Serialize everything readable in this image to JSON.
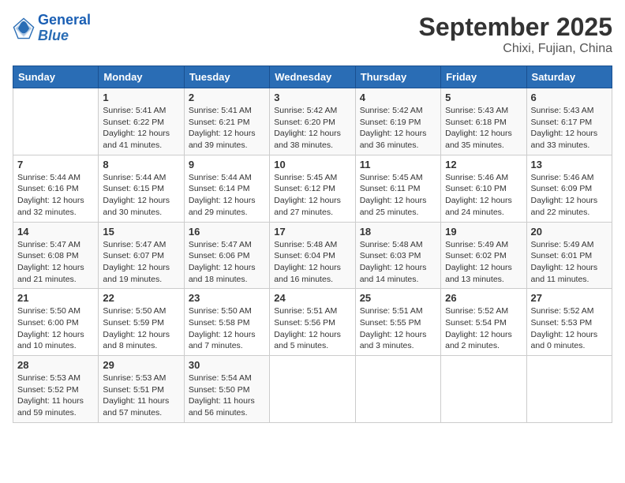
{
  "header": {
    "logo_line1": "General",
    "logo_line2": "Blue",
    "month": "September 2025",
    "location": "Chixi, Fujian, China"
  },
  "days_of_week": [
    "Sunday",
    "Monday",
    "Tuesday",
    "Wednesday",
    "Thursday",
    "Friday",
    "Saturday"
  ],
  "weeks": [
    [
      {
        "day": "",
        "info": ""
      },
      {
        "day": "1",
        "info": "Sunrise: 5:41 AM\nSunset: 6:22 PM\nDaylight: 12 hours\nand 41 minutes."
      },
      {
        "day": "2",
        "info": "Sunrise: 5:41 AM\nSunset: 6:21 PM\nDaylight: 12 hours\nand 39 minutes."
      },
      {
        "day": "3",
        "info": "Sunrise: 5:42 AM\nSunset: 6:20 PM\nDaylight: 12 hours\nand 38 minutes."
      },
      {
        "day": "4",
        "info": "Sunrise: 5:42 AM\nSunset: 6:19 PM\nDaylight: 12 hours\nand 36 minutes."
      },
      {
        "day": "5",
        "info": "Sunrise: 5:43 AM\nSunset: 6:18 PM\nDaylight: 12 hours\nand 35 minutes."
      },
      {
        "day": "6",
        "info": "Sunrise: 5:43 AM\nSunset: 6:17 PM\nDaylight: 12 hours\nand 33 minutes."
      }
    ],
    [
      {
        "day": "7",
        "info": "Sunrise: 5:44 AM\nSunset: 6:16 PM\nDaylight: 12 hours\nand 32 minutes."
      },
      {
        "day": "8",
        "info": "Sunrise: 5:44 AM\nSunset: 6:15 PM\nDaylight: 12 hours\nand 30 minutes."
      },
      {
        "day": "9",
        "info": "Sunrise: 5:44 AM\nSunset: 6:14 PM\nDaylight: 12 hours\nand 29 minutes."
      },
      {
        "day": "10",
        "info": "Sunrise: 5:45 AM\nSunset: 6:12 PM\nDaylight: 12 hours\nand 27 minutes."
      },
      {
        "day": "11",
        "info": "Sunrise: 5:45 AM\nSunset: 6:11 PM\nDaylight: 12 hours\nand 25 minutes."
      },
      {
        "day": "12",
        "info": "Sunrise: 5:46 AM\nSunset: 6:10 PM\nDaylight: 12 hours\nand 24 minutes."
      },
      {
        "day": "13",
        "info": "Sunrise: 5:46 AM\nSunset: 6:09 PM\nDaylight: 12 hours\nand 22 minutes."
      }
    ],
    [
      {
        "day": "14",
        "info": "Sunrise: 5:47 AM\nSunset: 6:08 PM\nDaylight: 12 hours\nand 21 minutes."
      },
      {
        "day": "15",
        "info": "Sunrise: 5:47 AM\nSunset: 6:07 PM\nDaylight: 12 hours\nand 19 minutes."
      },
      {
        "day": "16",
        "info": "Sunrise: 5:47 AM\nSunset: 6:06 PM\nDaylight: 12 hours\nand 18 minutes."
      },
      {
        "day": "17",
        "info": "Sunrise: 5:48 AM\nSunset: 6:04 PM\nDaylight: 12 hours\nand 16 minutes."
      },
      {
        "day": "18",
        "info": "Sunrise: 5:48 AM\nSunset: 6:03 PM\nDaylight: 12 hours\nand 14 minutes."
      },
      {
        "day": "19",
        "info": "Sunrise: 5:49 AM\nSunset: 6:02 PM\nDaylight: 12 hours\nand 13 minutes."
      },
      {
        "day": "20",
        "info": "Sunrise: 5:49 AM\nSunset: 6:01 PM\nDaylight: 12 hours\nand 11 minutes."
      }
    ],
    [
      {
        "day": "21",
        "info": "Sunrise: 5:50 AM\nSunset: 6:00 PM\nDaylight: 12 hours\nand 10 minutes."
      },
      {
        "day": "22",
        "info": "Sunrise: 5:50 AM\nSunset: 5:59 PM\nDaylight: 12 hours\nand 8 minutes."
      },
      {
        "day": "23",
        "info": "Sunrise: 5:50 AM\nSunset: 5:58 PM\nDaylight: 12 hours\nand 7 minutes."
      },
      {
        "day": "24",
        "info": "Sunrise: 5:51 AM\nSunset: 5:56 PM\nDaylight: 12 hours\nand 5 minutes."
      },
      {
        "day": "25",
        "info": "Sunrise: 5:51 AM\nSunset: 5:55 PM\nDaylight: 12 hours\nand 3 minutes."
      },
      {
        "day": "26",
        "info": "Sunrise: 5:52 AM\nSunset: 5:54 PM\nDaylight: 12 hours\nand 2 minutes."
      },
      {
        "day": "27",
        "info": "Sunrise: 5:52 AM\nSunset: 5:53 PM\nDaylight: 12 hours\nand 0 minutes."
      }
    ],
    [
      {
        "day": "28",
        "info": "Sunrise: 5:53 AM\nSunset: 5:52 PM\nDaylight: 11 hours\nand 59 minutes."
      },
      {
        "day": "29",
        "info": "Sunrise: 5:53 AM\nSunset: 5:51 PM\nDaylight: 11 hours\nand 57 minutes."
      },
      {
        "day": "30",
        "info": "Sunrise: 5:54 AM\nSunset: 5:50 PM\nDaylight: 11 hours\nand 56 minutes."
      },
      {
        "day": "",
        "info": ""
      },
      {
        "day": "",
        "info": ""
      },
      {
        "day": "",
        "info": ""
      },
      {
        "day": "",
        "info": ""
      }
    ]
  ]
}
